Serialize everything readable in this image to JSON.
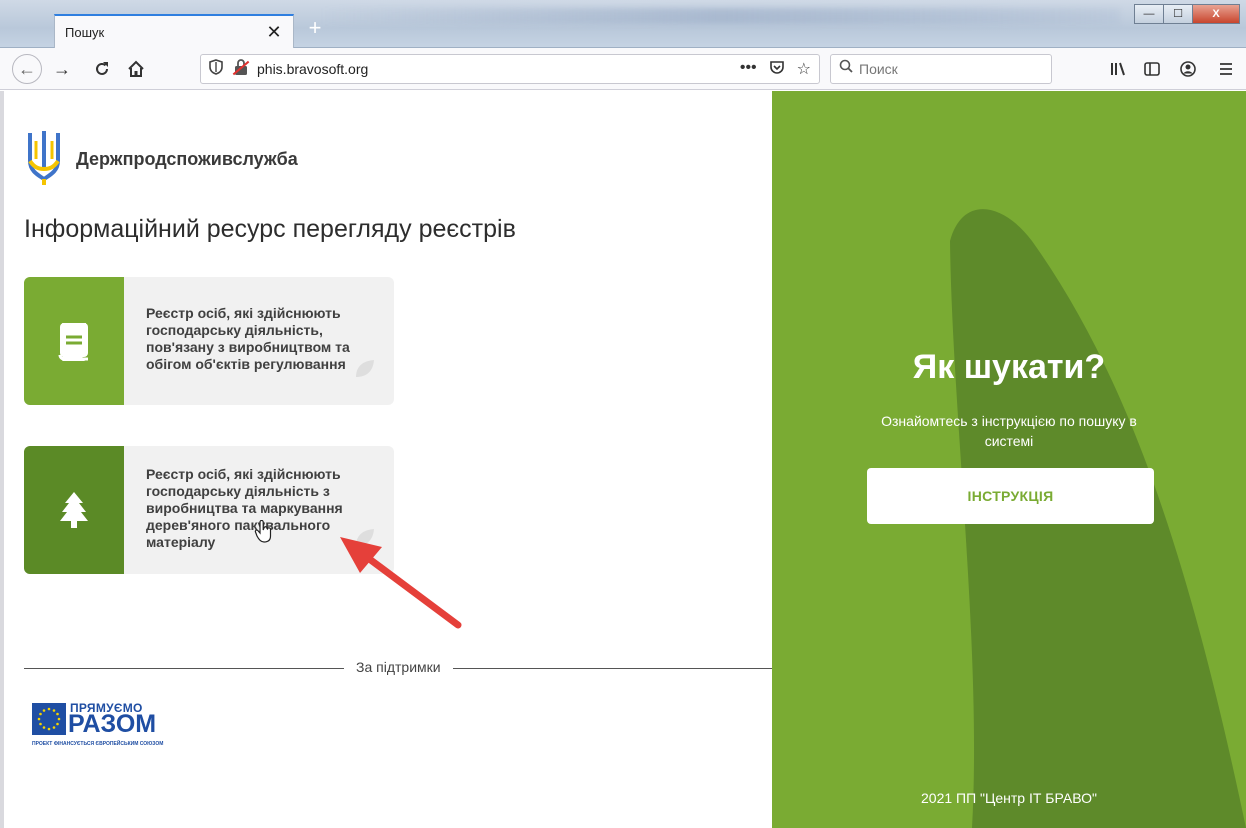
{
  "browser": {
    "tab_title": "Пошук",
    "tab_close": "✕",
    "new_tab": "+",
    "url": "phis.bravosoft.org",
    "search_placeholder": "Поиск",
    "window_min": "—",
    "window_max": "☐",
    "window_close": "X"
  },
  "header": {
    "brand_name": "Держпродспоживслужба",
    "page_title": "Інформаційний ресурс перегляду реєстрів"
  },
  "cards": [
    {
      "text": "Реєстр осіб, які здійснюють господарську діяльність, пов'язану з виробництвом та обігом об'єктів регулювання",
      "icon": "book-icon"
    },
    {
      "text": "Реєстр осіб, які здійснюють господарську діяльність з виробництва та маркування дерев'яного пакувального матеріалу",
      "icon": "tree-icon"
    }
  ],
  "support": {
    "label": "За підтримки",
    "logo_top": "ПРЯМУЄМО",
    "logo_bottom": "РАЗОМ",
    "logo_caption": "ПРОЕКТ ФІНАНСУЄТЬСЯ ЄВРОПЕЙСЬКИМ СОЮЗОМ"
  },
  "help_panel": {
    "title": "Як шукати?",
    "subtitle": "Ознайомтесь з інструкцією по пошуку в системі",
    "button_label": "ІНСТРУКЦІЯ",
    "footer": "2021 ПП \"Центр ІТ БРАВО\""
  },
  "colors": {
    "brand_green": "#7aab33",
    "dark_green": "#5b8a26",
    "arrow_red": "#e5403a",
    "eu_blue": "#1f4ea3"
  }
}
